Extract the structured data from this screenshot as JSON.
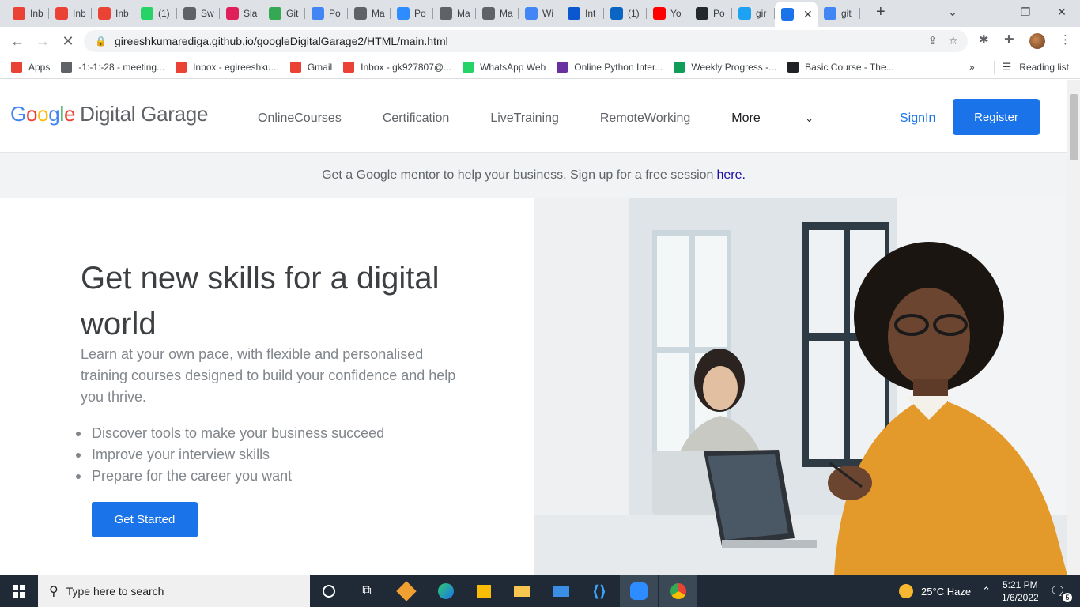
{
  "browser": {
    "tabs": [
      {
        "label": "Inb",
        "icon": "gmail-icon"
      },
      {
        "label": "Inb",
        "icon": "gmail-icon"
      },
      {
        "label": "Inb",
        "icon": "gmail-icon"
      },
      {
        "label": "(1)",
        "icon": "whatsapp-icon"
      },
      {
        "label": "Sw",
        "icon": "globe-icon"
      },
      {
        "label": "Sla",
        "icon": "slack-icon"
      },
      {
        "label": "Git",
        "icon": "google-drive-icon"
      },
      {
        "label": "Po",
        "icon": "docs-icon"
      },
      {
        "label": "Ma",
        "icon": "globe-icon"
      },
      {
        "label": "Po",
        "icon": "zoom-icon"
      },
      {
        "label": "Ma",
        "icon": "globe-icon"
      },
      {
        "label": "Ma",
        "icon": "globe-icon"
      },
      {
        "label": "Wi",
        "icon": "docs-icon"
      },
      {
        "label": "Int",
        "icon": "mail-icon"
      },
      {
        "label": "(1)",
        "icon": "linkedin-icon"
      },
      {
        "label": "Yo",
        "icon": "youtube-icon"
      },
      {
        "label": "Po",
        "icon": "github-icon"
      },
      {
        "label": "gir",
        "icon": "twitter-icon"
      },
      {
        "label": "",
        "icon": "loading-icon"
      },
      {
        "label": "git",
        "icon": "google-icon"
      }
    ],
    "url": "gireeshkumarediga.github.io/googleDigitalGarage2/HTML/main.html",
    "bookmarks": [
      {
        "label": "Apps",
        "icon": "apps-grid-icon"
      },
      {
        "label": "-1:-1:-28 - meeting...",
        "icon": "clock-icon"
      },
      {
        "label": "Inbox - egireeshku...",
        "icon": "gmail-icon"
      },
      {
        "label": "Gmail",
        "icon": "gmail-icon"
      },
      {
        "label": "Inbox - gk927807@...",
        "icon": "gmail-icon"
      },
      {
        "label": "WhatsApp Web",
        "icon": "whatsapp-icon"
      },
      {
        "label": "Online Python Inter...",
        "icon": "python-icon"
      },
      {
        "label": "Weekly Progress -...",
        "icon": "sheets-icon"
      },
      {
        "label": "Basic Course - The...",
        "icon": "paw-icon"
      }
    ],
    "overflow": "»",
    "reading_list": "Reading list"
  },
  "site": {
    "logo_google": [
      "G",
      "o",
      "o",
      "g",
      "l",
      "e"
    ],
    "logo_suffix": "Digital Garage",
    "nav": [
      "OnlineCourses",
      "Certification",
      "LiveTraining",
      "RemoteWorking"
    ],
    "nav_more": "More",
    "signin": "SignIn",
    "register": "Register",
    "banner_text": "Get a Google mentor to help your business. Sign up for a free session",
    "banner_link": "here.",
    "hero_title": "Get new skills for a digital world",
    "hero_desc": "Learn at your own pace, with flexible and personalised training courses designed to build your confidence and help you thrive.",
    "hero_list": [
      "Discover tools to make your business succeed",
      "Improve your interview skills",
      "Prepare for the career you want"
    ],
    "cta": "Get Started"
  },
  "taskbar": {
    "search_placeholder": "Type here to search",
    "weather": "25°C  Haze",
    "time": "5:21 PM",
    "date": "1/6/2022",
    "notifications": "5"
  },
  "colors": {
    "accent": "#1a73e8",
    "banner_link": "#1a0dab",
    "text_muted": "#80868b"
  }
}
